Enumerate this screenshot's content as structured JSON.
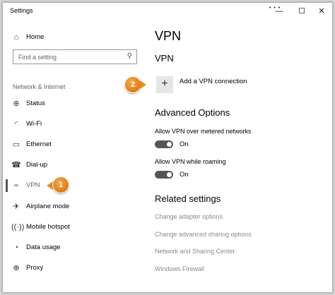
{
  "window": {
    "title": "Settings",
    "controls": {
      "minimize": "—",
      "maximize": "☐",
      "close": "✕"
    }
  },
  "sidebar": {
    "home": {
      "label": "Home",
      "icon": "home-icon"
    },
    "search": {
      "placeholder": "Find a setting"
    },
    "group_label": "Network & Internet",
    "items": [
      {
        "label": "Status",
        "icon": "globe-icon"
      },
      {
        "label": "Wi-Fi",
        "icon": "wifi-icon"
      },
      {
        "label": "Ethernet",
        "icon": "ethernet-icon"
      },
      {
        "label": "Dial-up",
        "icon": "phone-icon"
      },
      {
        "label": "VPN",
        "icon": "vpn-icon",
        "selected": true
      },
      {
        "label": "Airplane mode",
        "icon": "airplane-icon"
      },
      {
        "label": "Mobile hotspot",
        "icon": "hotspot-icon"
      },
      {
        "label": "Data usage",
        "icon": "clock-icon"
      },
      {
        "label": "Proxy",
        "icon": "globe-icon"
      }
    ]
  },
  "main": {
    "title": "VPN",
    "vpn_section": "VPN",
    "add_vpn": "Add a VPN connection",
    "advanced_title": "Advanced Options",
    "metered": {
      "label": "Allow VPN over metered networks",
      "state": "On"
    },
    "roaming": {
      "label": "Allow VPN while roaming",
      "state": "On"
    },
    "related_title": "Related settings",
    "links": [
      "Change adapter options",
      "Change advanced sharing options",
      "Network and Sharing Center",
      "Windows Firewall"
    ]
  },
  "annotations": {
    "step1": "1",
    "step2": "2"
  },
  "colors": {
    "callout": "#e88a22",
    "toggle_on": "#555555",
    "link": "#8a8a8a"
  }
}
